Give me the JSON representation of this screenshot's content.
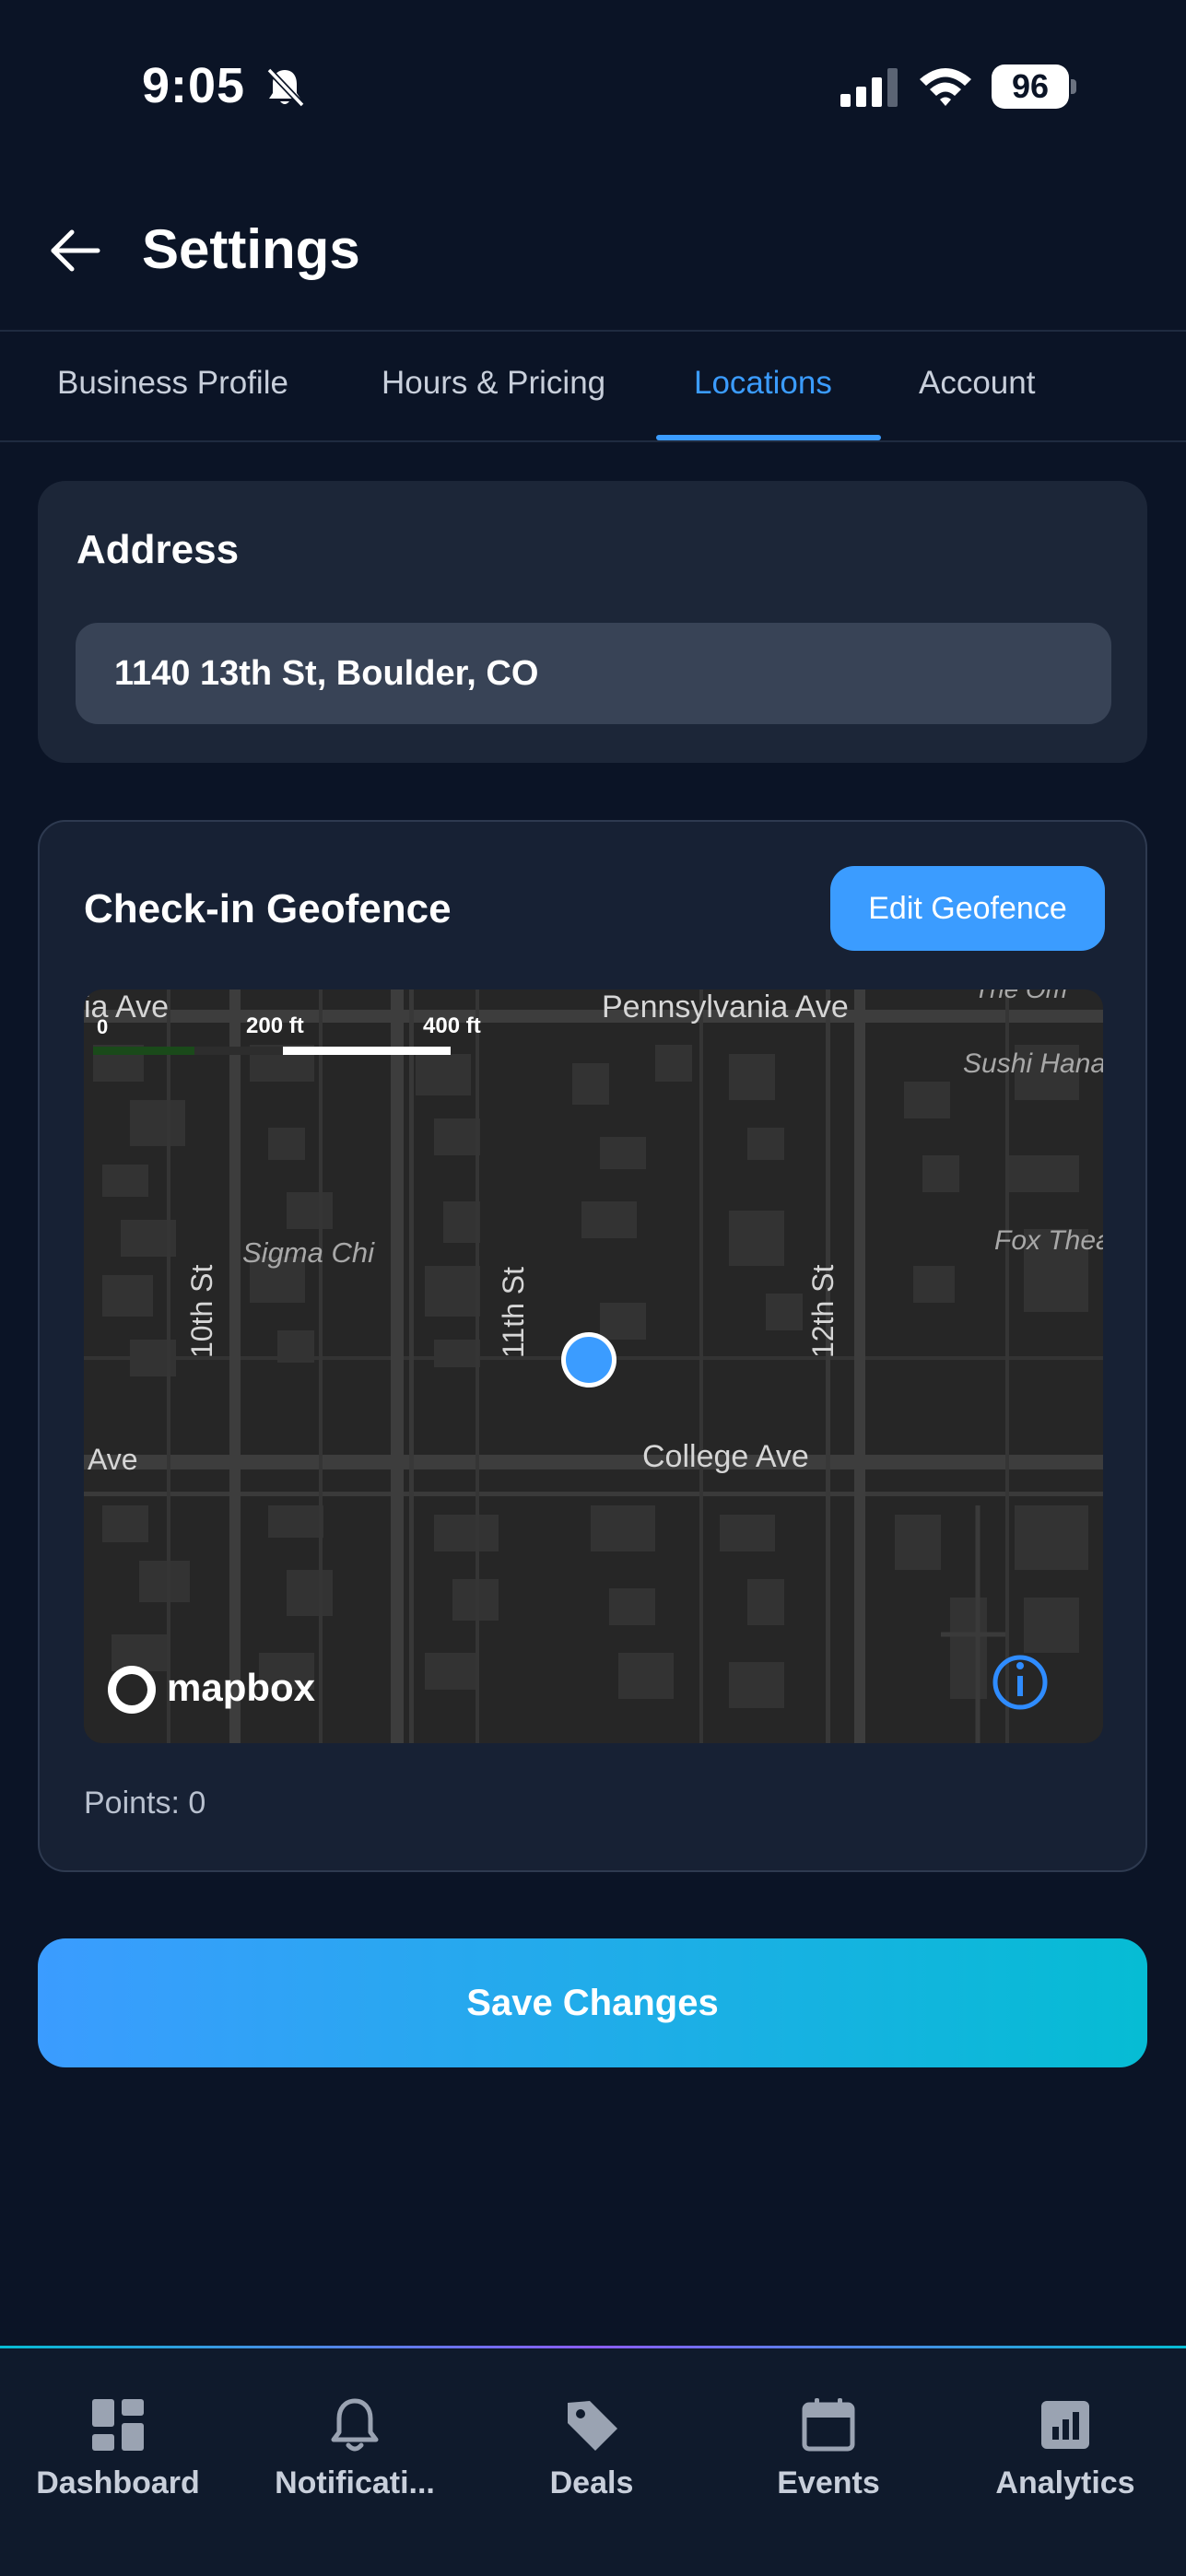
{
  "status_bar": {
    "time": "9:05",
    "battery": "96"
  },
  "header": {
    "title": "Settings"
  },
  "tabs": [
    {
      "label": "Business Profile",
      "active": false
    },
    {
      "label": "Hours & Pricing",
      "active": false
    },
    {
      "label": "Locations",
      "active": true
    },
    {
      "label": "Account",
      "active": false
    }
  ],
  "address": {
    "heading": "Address",
    "value": "1140 13th St, Boulder, CO"
  },
  "geofence": {
    "heading": "Check-in Geofence",
    "edit_label": "Edit Geofence",
    "points_label": "Points: 0",
    "map": {
      "streets": [
        "Pennsylvania Ave",
        "ia Ave",
        "College Ave",
        "Ave",
        "10th St",
        "11th St",
        "12th St"
      ],
      "pois": [
        "Sigma Chi",
        "Sushi Hana",
        "Fox Thea",
        "The Om"
      ],
      "scale": [
        "0",
        "200 ft",
        "400 ft"
      ],
      "attribution": "mapbox"
    }
  },
  "save_label": "Save Changes",
  "bottom_nav": [
    {
      "label": "Dashboard",
      "icon": "dashboard-icon"
    },
    {
      "label": "Notificati...",
      "icon": "bell-icon"
    },
    {
      "label": "Deals",
      "icon": "tag-icon"
    },
    {
      "label": "Events",
      "icon": "calendar-icon"
    },
    {
      "label": "Analytics",
      "icon": "bar-chart-icon"
    }
  ],
  "colors": {
    "background": "#0b1426",
    "card": "#1c2638",
    "accent": "#3b9cff",
    "accent_end": "#06bcd4"
  }
}
